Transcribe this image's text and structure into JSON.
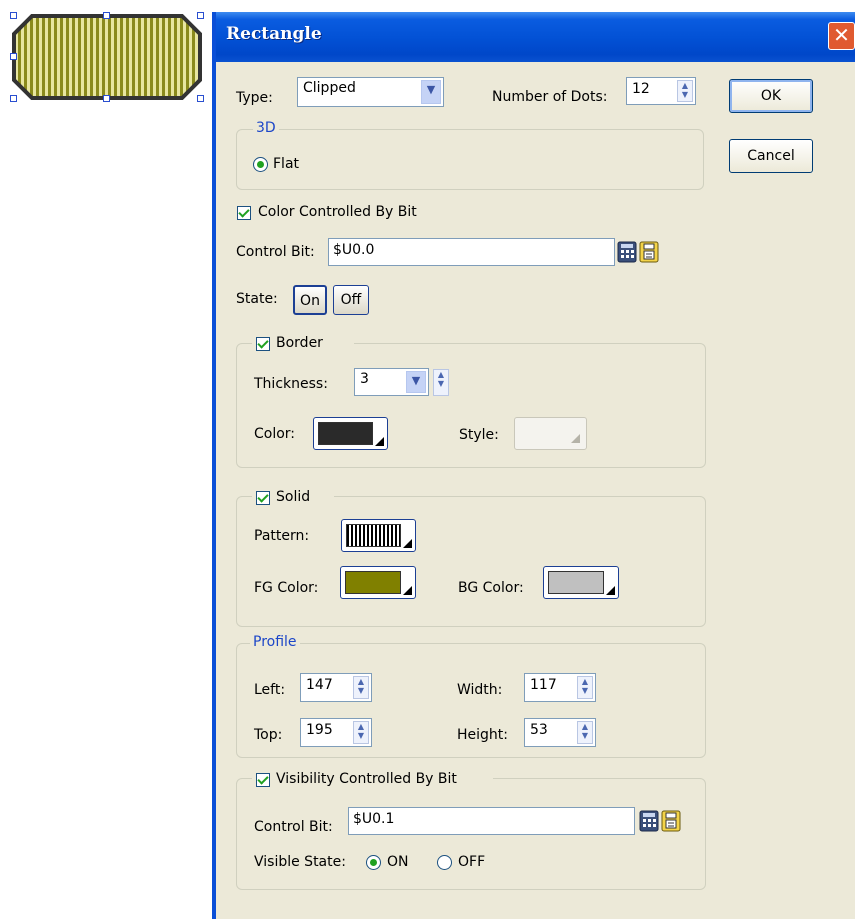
{
  "canvas": {
    "shape": "clipped-rectangle",
    "fill_pattern": "vertical-stripes",
    "fill_color": "#8a8a1c",
    "border_color": "#333333"
  },
  "dialog": {
    "title": "Rectangle",
    "type_label": "Type:",
    "type_value": "Clipped",
    "dots_label": "Number of Dots:",
    "dots_value": "12",
    "ok_label": "OK",
    "cancel_label": "Cancel",
    "group_3d": {
      "caption": "3D",
      "flat_label": "Flat"
    },
    "color_controlled_label": "Color Controlled By Bit",
    "control_bit_label": "Control Bit:",
    "control_bit_value": "$U0.0",
    "state_label": "State:",
    "state_on": "On",
    "state_off": "Off",
    "border": {
      "caption": "Border",
      "thickness_label": "Thickness:",
      "thickness_value": "3",
      "color_label": "Color:",
      "color": "#2a2a2a",
      "style_label": "Style:"
    },
    "solid": {
      "caption": "Solid",
      "pattern_label": "Pattern:",
      "fg_label": "FG Color:",
      "fg_color": "#808000",
      "bg_label": "BG Color:",
      "bg_color": "#c0c0c0"
    },
    "profile": {
      "caption": "Profile",
      "left_label": "Left:",
      "left_value": "147",
      "width_label": "Width:",
      "width_value": "117",
      "top_label": "Top:",
      "top_value": "195",
      "height_label": "Height:",
      "height_value": "53"
    },
    "visibility": {
      "caption": "Visibility Controlled By Bit",
      "control_bit_label": "Control Bit:",
      "control_bit_value": "$U0.1",
      "visible_state_label": "Visible State:",
      "on_label": "ON",
      "off_label": "OFF"
    }
  }
}
